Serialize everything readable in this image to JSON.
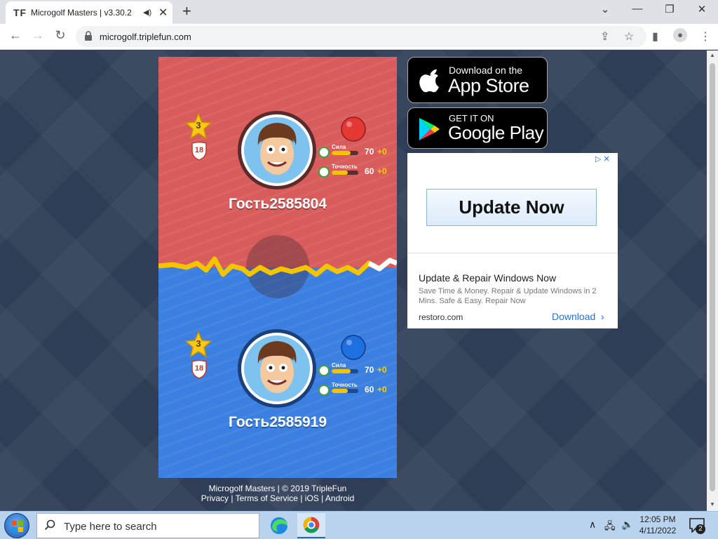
{
  "browser": {
    "favicon_text": "TF",
    "tab_title": "Microgolf Masters | v3.30.2",
    "new_tab": "+",
    "url": "microgolf.triplefun.com"
  },
  "game": {
    "players": [
      {
        "level": "3",
        "rank": "18",
        "ball_color": "#e53935",
        "stats": [
          {
            "label": "Сила",
            "value": "70",
            "bonus": "+0",
            "fill": 0.7
          },
          {
            "label": "Точность",
            "value": "60",
            "bonus": "+0",
            "fill": 0.6
          }
        ],
        "name": "Гость2585804"
      },
      {
        "level": "3",
        "rank": "18",
        "ball_color": "#1e6fe0",
        "stats": [
          {
            "label": "Сила",
            "value": "70",
            "bonus": "+0",
            "fill": 0.7
          },
          {
            "label": "Точность",
            "value": "60",
            "bonus": "+0",
            "fill": 0.6
          }
        ],
        "name": "Гость2585919"
      }
    ]
  },
  "footer": {
    "line1": "Microgolf Masters | © 2019 TripleFun",
    "privacy": "Privacy",
    "sep": " | ",
    "terms": "Terms of Service",
    "ios": "iOS",
    "android": "Android"
  },
  "stores": {
    "apple_small": "Download on the",
    "apple_big": "App Store",
    "google_small": "GET IT ON",
    "google_big": "Google Play"
  },
  "ad": {
    "cta": "Update Now",
    "title": "Update & Repair Windows Now",
    "description": "Save Time & Money. Repair & Update Windows in 2 Mins. Safe & Easy. Repair Now",
    "domain": "restoro.com",
    "download": "Download"
  },
  "taskbar": {
    "search_placeholder": "Type here to search",
    "time": "12:05 PM",
    "date": "4/11/2022",
    "notification_count": "2"
  }
}
